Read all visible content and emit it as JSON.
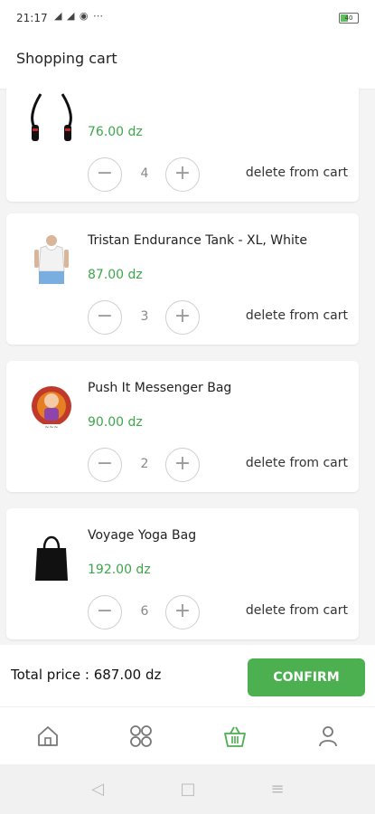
{
  "status_bar": {
    "time": "21:17",
    "icons": "◢ ◢ ◉ ⋯",
    "battery": "40"
  },
  "header": {
    "title": "Shopping cart"
  },
  "cart_items": [
    {
      "name": "",
      "price": "76.00 dz",
      "quantity": "4",
      "delete_label": "delete from cart",
      "image_icon": "jump-rope-icon"
    },
    {
      "name": "Tristan Endurance Tank - XL, White",
      "price": "87.00 dz",
      "quantity": "3",
      "delete_label": "delete from cart",
      "image_icon": "tank-top-icon"
    },
    {
      "name": "Push It Messenger Bag",
      "price": "90.00 dz",
      "quantity": "2",
      "delete_label": "delete from cart",
      "image_icon": "messenger-bag-icon"
    },
    {
      "name": "Voyage Yoga Bag",
      "price": "192.00 dz",
      "quantity": "6",
      "delete_label": "delete from cart",
      "image_icon": "tote-bag-icon"
    }
  ],
  "qty_buttons": {
    "minus": "−",
    "plus": "+"
  },
  "footer": {
    "total_label": "Total price : 687.00 dz",
    "confirm_label": "CONFIRM"
  },
  "bottom_nav": [
    {
      "icon": "home-icon"
    },
    {
      "icon": "categories-icon"
    },
    {
      "icon": "basket-icon",
      "active": true
    },
    {
      "icon": "profile-icon"
    }
  ],
  "system_nav": {
    "back": "◁",
    "home": "□",
    "menu": "≡"
  },
  "colors": {
    "accent": "#4caf50",
    "price": "#3ea64a",
    "nav_active": "#4caf50",
    "nav_inactive": "#777777"
  }
}
